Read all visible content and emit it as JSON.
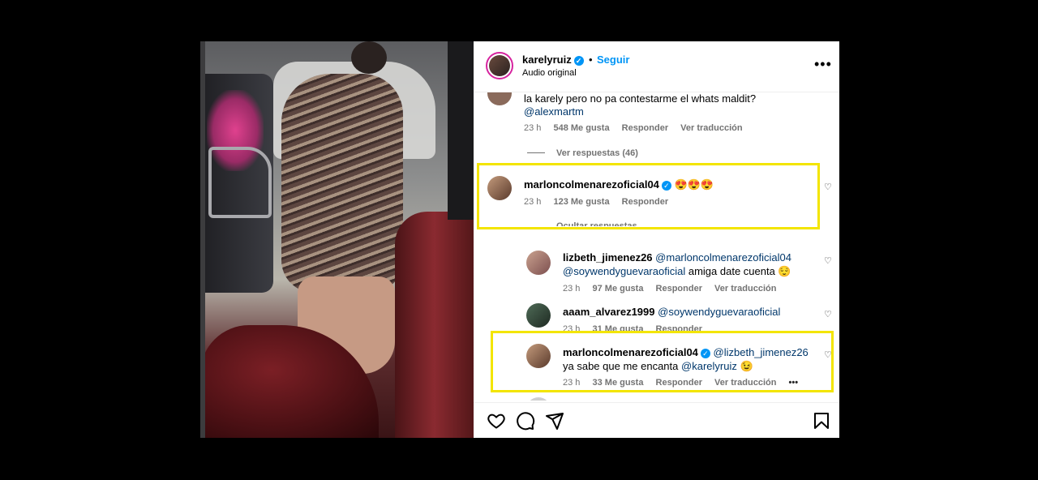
{
  "post": {
    "username": "karelyruiz",
    "follow_label": "Seguir",
    "subtitle": "Audio original",
    "more_label": "•••"
  },
  "comments": {
    "top": {
      "text": "la karely pero no pa contestarme el whats maldit?",
      "mention": "@alexmartm",
      "time": "23 h",
      "likes": "548 Me gusta",
      "reply": "Responder",
      "translate": "Ver traducción"
    },
    "view_replies": "Ver respuestas (46)",
    "main": {
      "username": "marloncolmenarezoficial04",
      "text": "😍😍😍",
      "time": "23 h",
      "likes": "123 Me gusta",
      "reply": "Responder",
      "hide_replies": "Ocultar respuestas"
    },
    "replies": [
      {
        "username": "lizbeth_jimenez26",
        "mention": "@marloncolmenarezoficial04",
        "line2_mention": "@soywendyguevaraoficial",
        "line2_text": "amiga date cuenta 😌",
        "time": "23 h",
        "likes": "97 Me gusta",
        "reply": "Responder",
        "translate": "Ver traducción"
      },
      {
        "username": "aaam_alvarez1999",
        "mention": "@soywendyguevaraoficial",
        "time": "23 h",
        "likes": "31 Me gusta",
        "reply": "Responder"
      },
      {
        "username": "marloncolmenarezoficial04",
        "mention": "@lizbeth_jimenez26",
        "line2_text": "ya sabe que me encanta",
        "line2_mention": "@karelyruiz",
        "line2_emoji": "😉",
        "time": "23 h",
        "likes": "33 Me gusta",
        "reply": "Responder",
        "translate": "Ver traducción",
        "more": "•••"
      }
    ]
  },
  "colors": {
    "highlight": "#f3e500",
    "verified": "#0095f6",
    "link": "#0095f6"
  },
  "icons": [
    "heart-icon",
    "comment-icon",
    "share-icon",
    "bookmark-icon",
    "verified-icon",
    "more-icon"
  ]
}
